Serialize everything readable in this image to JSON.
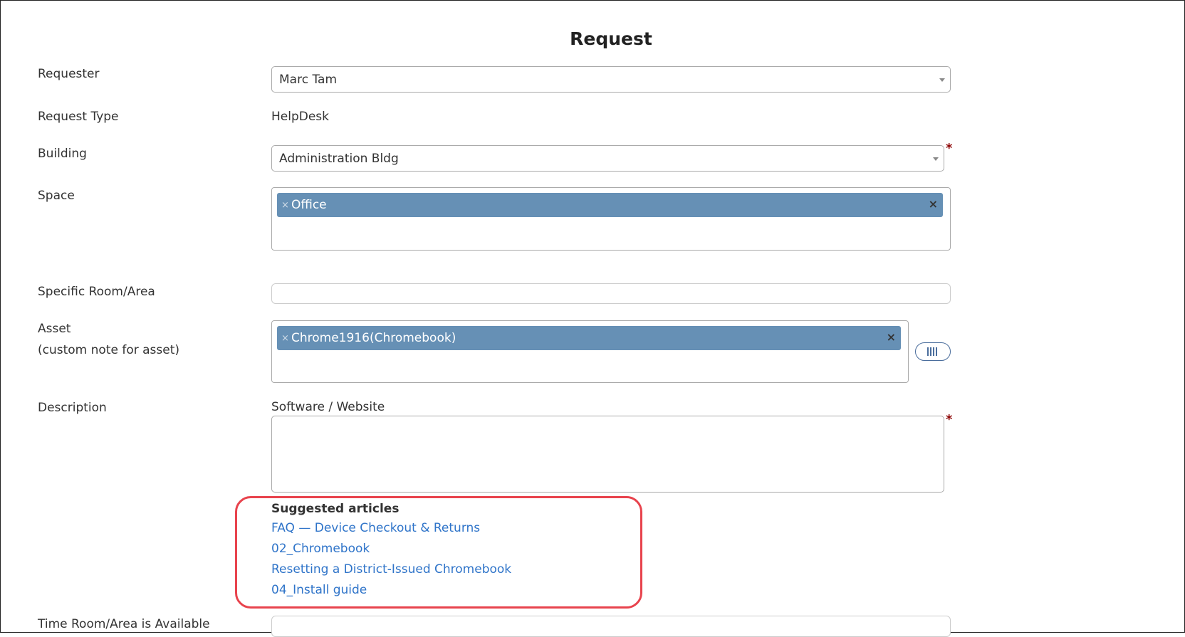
{
  "page": {
    "title": "Request"
  },
  "form": {
    "requester": {
      "label": "Requester",
      "value": "Marc Tam"
    },
    "request_type": {
      "label": "Request Type",
      "value": "HelpDesk"
    },
    "building": {
      "label": "Building",
      "value": "Administration Bldg",
      "required_mark": "*"
    },
    "space": {
      "label": "Space",
      "chip": "Office",
      "chip_remove": "×",
      "clear": "×"
    },
    "specific_room": {
      "label": "Specific Room/Area",
      "value": ""
    },
    "asset": {
      "label": "Asset",
      "note": "(custom note for asset)",
      "chip": "Chrome1916(Chromebook)",
      "chip_remove": "×",
      "clear": "×",
      "scan_icon": "barcode-icon"
    },
    "description": {
      "label": "Description",
      "category": "Software / Website",
      "required_mark": "*",
      "value": ""
    },
    "suggested_articles": {
      "heading": "Suggested articles",
      "items": [
        "FAQ — Device Checkout & Returns",
        "02_Chromebook",
        "Resetting a District-Issued Chromebook",
        "04_Install guide"
      ]
    },
    "time_available": {
      "label": "Time Room/Area is Available"
    }
  },
  "colors": {
    "chip": "#6690b5",
    "link": "#2f74c9",
    "highlight": "#e8434d",
    "required": "#8b0000"
  }
}
